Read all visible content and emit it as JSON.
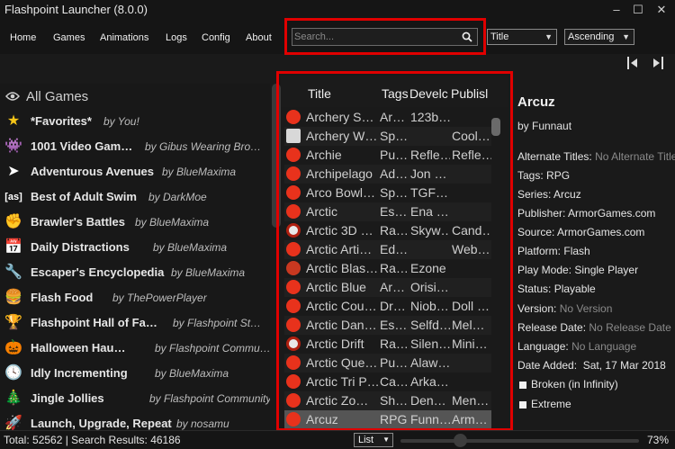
{
  "window": {
    "title": "Flashpoint Launcher (8.0.0)",
    "minimize_icon": "minimize-icon",
    "maximize_icon": "maximize-icon",
    "close_icon": "close-icon"
  },
  "nav": [
    "Home",
    "Games",
    "Animations",
    "Logs",
    "Config",
    "About"
  ],
  "search": {
    "placeholder": "Search...",
    "value": ""
  },
  "order": {
    "by": "Title",
    "direction": "Ascending"
  },
  "sidebar": {
    "all_label": "All Games",
    "playlists": [
      {
        "name": "*Favorites*",
        "by": "by You!",
        "icon": "star-icon",
        "glyph": "★",
        "color": "#f5c518"
      },
      {
        "name": "1001 Video Gam…",
        "by": "by Gibus Wearing Bro…",
        "icon": "invader-icon",
        "glyph": "👾",
        "color": "#dddddd"
      },
      {
        "name": "Adventurous Avenues",
        "by": "by BlueMaxima",
        "icon": "cursor-icon",
        "glyph": "➤",
        "color": "#ffffff"
      },
      {
        "name": "Best of Adult Swim",
        "by": "by DarkMoe",
        "icon": "adultswim-icon",
        "glyph": "[as]",
        "color": "#ffffff"
      },
      {
        "name": "Brawler's Battles",
        "by": "by BlueMaxima",
        "icon": "fist-icon",
        "glyph": "✊",
        "color": "#e8b48a"
      },
      {
        "name": "Daily Distractions",
        "by": "by BlueMaxima",
        "icon": "calendar-icon",
        "glyph": "📅",
        "color": "#e05050"
      },
      {
        "name": "Escaper's Encyclopedia",
        "by": "by BlueMaxima",
        "icon": "key-icon",
        "glyph": "🔧",
        "color": "#aaaaaa"
      },
      {
        "name": "Flash Food",
        "by": "by ThePowerPlayer",
        "icon": "burger-icon",
        "glyph": "🍔",
        "color": "#d89a40"
      },
      {
        "name": "Flashpoint Hall of Fa…",
        "by": "by Flashpoint St…",
        "icon": "trophy-icon",
        "glyph": "🏆",
        "color": "#e0a020"
      },
      {
        "name": "Halloween Hau…",
        "by": "by Flashpoint Commu…",
        "icon": "pumpkin-icon",
        "glyph": "🎃",
        "color": "#e07020"
      },
      {
        "name": "Idly Incrementing",
        "by": "by BlueMaxima",
        "icon": "clock-icon",
        "glyph": "🕓",
        "color": "#ffffff"
      },
      {
        "name": "Jingle Jollies",
        "by": "by Flashpoint Community",
        "icon": "tree-icon",
        "glyph": "🎄",
        "color": "#40a040"
      },
      {
        "name": "Launch, Upgrade, Repeat",
        "by": "by nosamu",
        "icon": "rocket-icon",
        "glyph": "🚀",
        "color": "#dddddd"
      }
    ]
  },
  "game_list": {
    "headers": [
      "Title",
      "Tags",
      "Develc",
      "Publisl"
    ],
    "rows": [
      {
        "title": "Archery S…",
        "tags": "Ar…",
        "dev": "123b…",
        "pub": "",
        "icon": "flash-icon"
      },
      {
        "title": "Archery W…",
        "tags": "Sp…",
        "dev": "",
        "pub": "Cool…",
        "icon": "pdf-icon"
      },
      {
        "title": "Archie",
        "tags": "Pu…",
        "dev": "Refle…",
        "pub": "Refle…",
        "icon": "flash-icon"
      },
      {
        "title": "Archipelago",
        "tags": "Ad…",
        "dev": "Jon …",
        "pub": "",
        "icon": "flash-icon"
      },
      {
        "title": "Arco Bowl…",
        "tags": "Sp…",
        "dev": "TGF…",
        "pub": "",
        "icon": "flash-icon"
      },
      {
        "title": "Arctic",
        "tags": "Es…",
        "dev": "Ena …",
        "pub": "",
        "icon": "flash-icon"
      },
      {
        "title": "Arctic 3D …",
        "tags": "Ra…",
        "dev": "Skyw…",
        "pub": "Cand…",
        "icon": "shockwave-icon"
      },
      {
        "title": "Arctic Arti…",
        "tags": "Ed…",
        "dev": "",
        "pub": "Web…",
        "icon": "flash-icon"
      },
      {
        "title": "Arctic Blas…",
        "tags": "Ra…",
        "dev": "Ezone",
        "pub": "",
        "icon": "unity-icon"
      },
      {
        "title": "Arctic Blue",
        "tags": "Ar…",
        "dev": "Orisi…",
        "pub": "",
        "icon": "flash-icon"
      },
      {
        "title": "Arctic Cou…",
        "tags": "Dr…",
        "dev": "Niob…",
        "pub": "Doll …",
        "icon": "flash-icon"
      },
      {
        "title": "Arctic Dan…",
        "tags": "Es…",
        "dev": "Selfd…",
        "pub": "Mel…",
        "icon": "flash-icon"
      },
      {
        "title": "Arctic Drift",
        "tags": "Ra…",
        "dev": "Silen…",
        "pub": "Mini…",
        "icon": "shockwave-icon"
      },
      {
        "title": "Arctic Que…",
        "tags": "Pu…",
        "dev": "Alaw…",
        "pub": "",
        "icon": "flash-icon"
      },
      {
        "title": "Arctic Tri P…",
        "tags": "Ca…",
        "dev": "Arka…",
        "pub": "",
        "icon": "flash-icon"
      },
      {
        "title": "Arctic Zo…",
        "tags": "Sh…",
        "dev": "Den…",
        "pub": "Men…",
        "icon": "flash-icon"
      },
      {
        "title": "Arcuz",
        "tags": "RPG",
        "dev": "Funn…",
        "pub": "Arm…",
        "icon": "flash-icon"
      }
    ],
    "selected_index": 16
  },
  "detail": {
    "title": "Arcuz",
    "by": "by Funnaut",
    "alternate_titles_label": "Alternate Titles:",
    "alternate_titles_value": "No Alternate Titles",
    "tags_label": "Tags:",
    "tags_value": "RPG",
    "series_label": "Series:",
    "series_value": "Arcuz",
    "publisher_label": "Publisher:",
    "publisher_value": "ArmorGames.com",
    "source_label": "Source:",
    "source_value": "ArmorGames.com",
    "platform_label": "Platform:",
    "platform_value": "Flash",
    "playmode_label": "Play Mode:",
    "playmode_value": "Single Player",
    "status_label": "Status:",
    "status_value": "Playable",
    "version_label": "Version:",
    "version_value": "No Version",
    "release_label": "Release Date:",
    "release_value": "No Release Date",
    "language_label": "Language:",
    "language_value": "No Language",
    "added_label": "Date Added:",
    "added_value": "Sat, 17 Mar 2018",
    "broken_label": "Broken (in Infinity)",
    "extreme_label": "Extreme"
  },
  "footer": {
    "stats": "Total: 52562  |  Search Results: 46186",
    "view_mode": "List",
    "zoom_value": 0.73,
    "zoom_label": "73%"
  },
  "colors": {
    "highlight": "#e00000",
    "flash_icon": "#e8321c",
    "selected_row": "#555555"
  }
}
